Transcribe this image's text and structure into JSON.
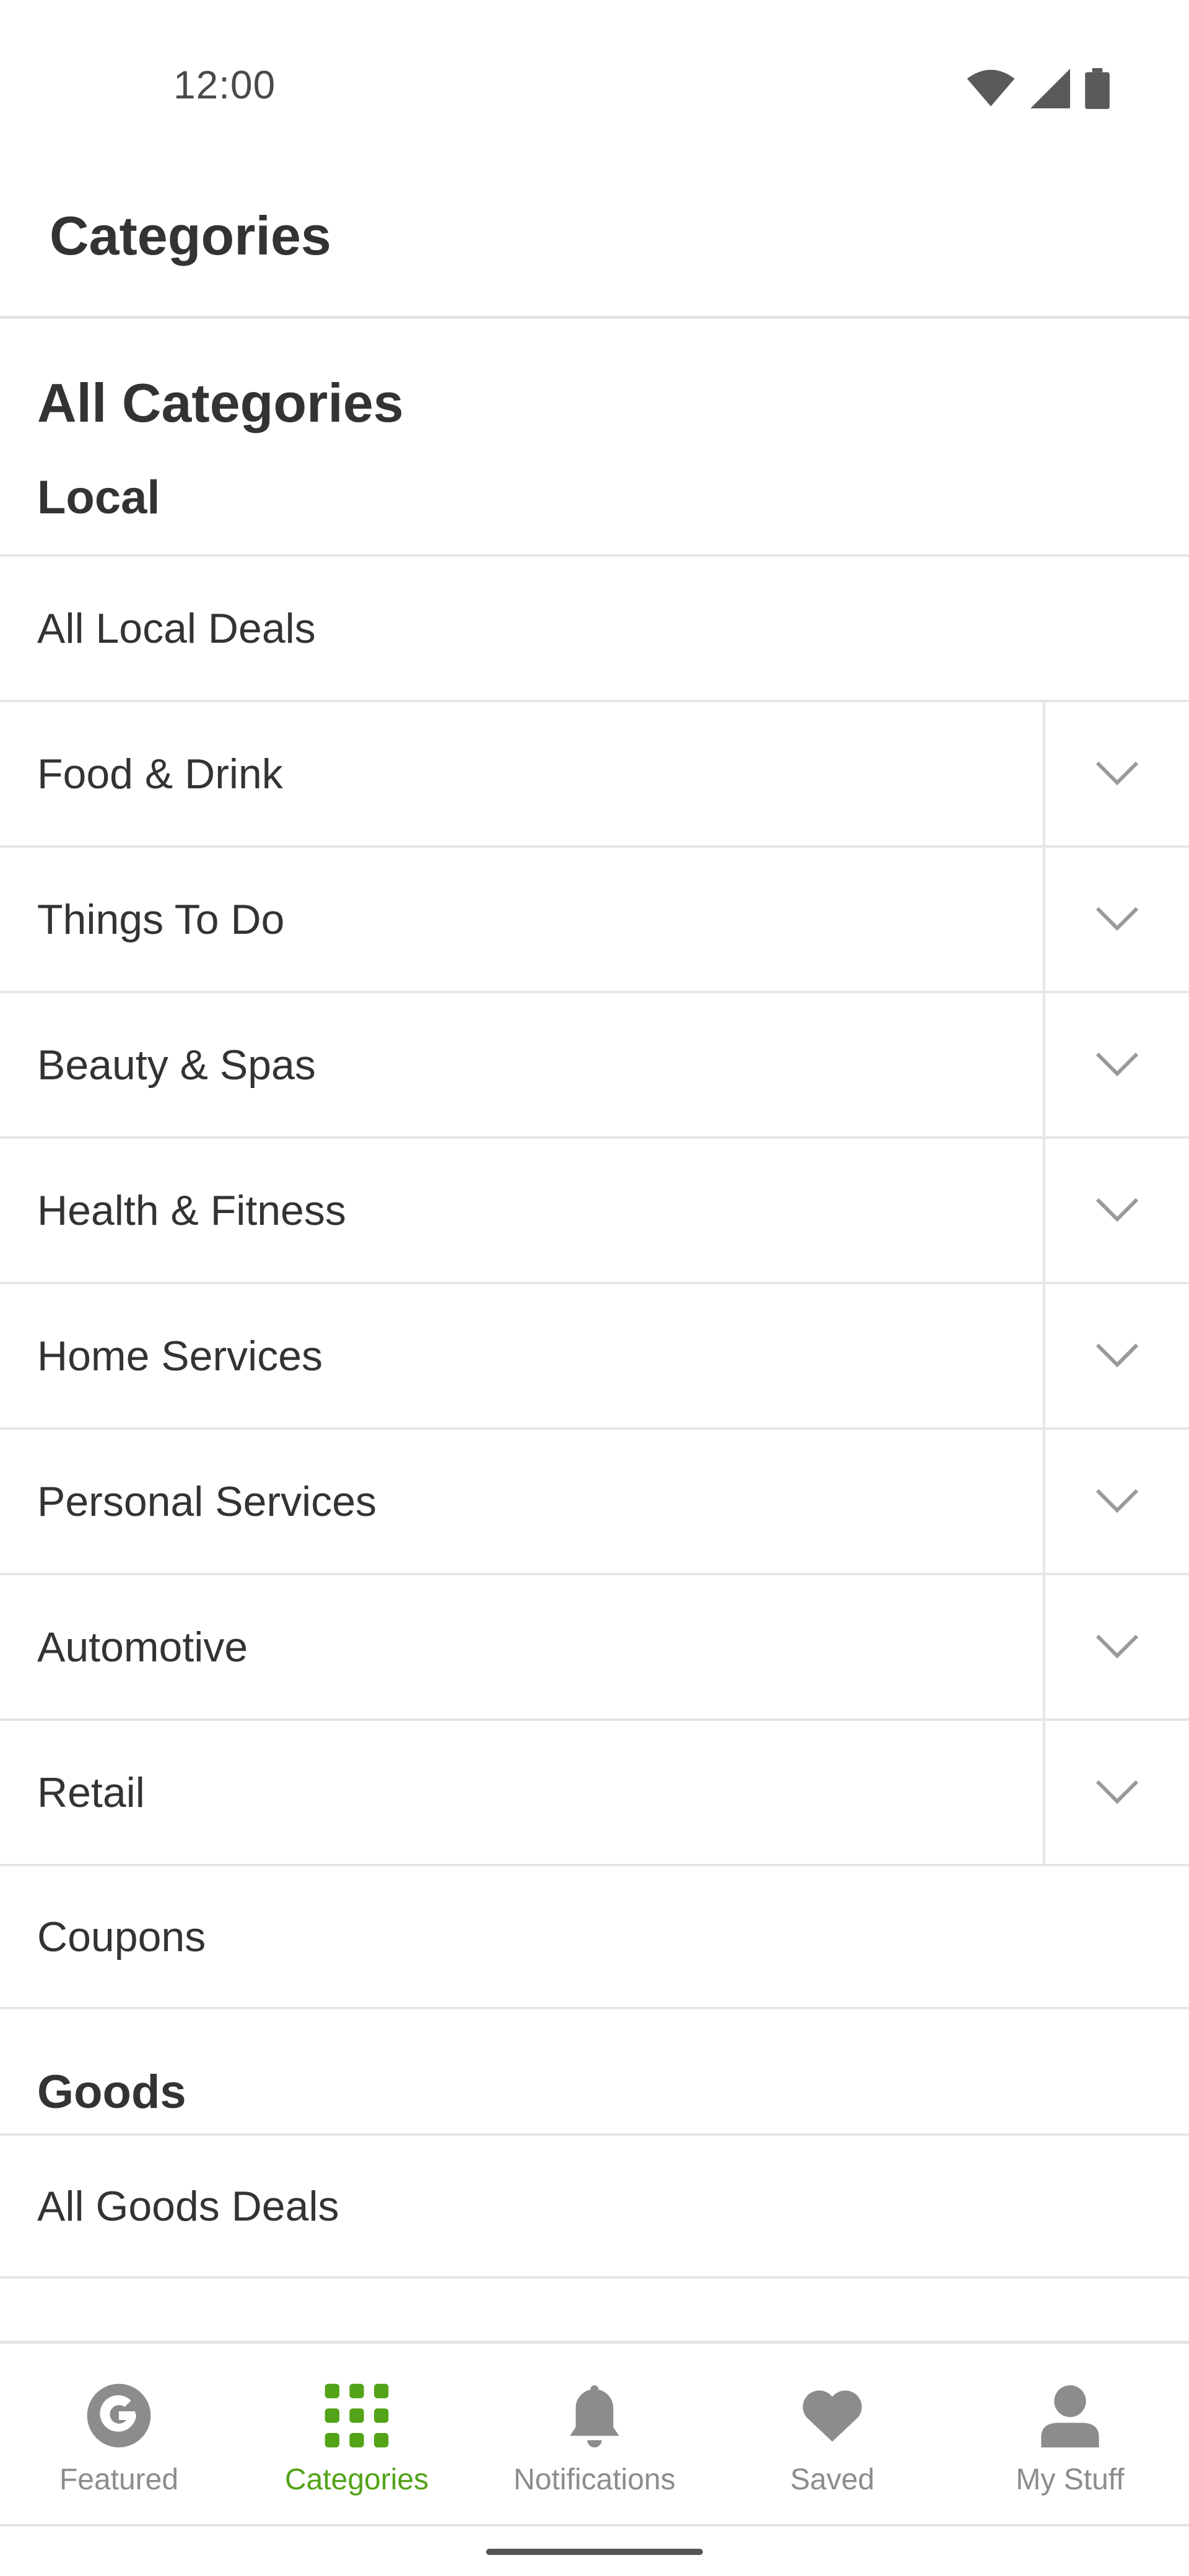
{
  "status_bar": {
    "time": "12:00"
  },
  "app_bar": {
    "title": "Categories"
  },
  "content": {
    "section_title": "All Categories",
    "groups": [
      {
        "heading": "Local",
        "items": [
          {
            "label": "All Local Deals",
            "expandable": false
          },
          {
            "label": "Food & Drink",
            "expandable": true
          },
          {
            "label": "Things To Do",
            "expandable": true
          },
          {
            "label": "Beauty & Spas",
            "expandable": true
          },
          {
            "label": "Health & Fitness",
            "expandable": true
          },
          {
            "label": "Home Services",
            "expandable": true
          },
          {
            "label": "Personal Services",
            "expandable": true
          },
          {
            "label": "Automotive",
            "expandable": true
          },
          {
            "label": "Retail",
            "expandable": true
          },
          {
            "label": "Coupons",
            "expandable": false
          }
        ]
      },
      {
        "heading": "Goods",
        "items": [
          {
            "label": "All Goods Deals",
            "expandable": false
          }
        ]
      }
    ]
  },
  "bottom_nav": {
    "items": [
      {
        "label": "Featured",
        "icon": "groupon-g-icon",
        "active": false
      },
      {
        "label": "Categories",
        "icon": "grid-icon",
        "active": true
      },
      {
        "label": "Notifications",
        "icon": "bell-icon",
        "active": false
      },
      {
        "label": "Saved",
        "icon": "heart-icon",
        "active": false
      },
      {
        "label": "My Stuff",
        "icon": "person-icon",
        "active": false
      }
    ]
  },
  "colors": {
    "accent": "#53a318",
    "inactive": "#8c8c8c",
    "text": "#333333",
    "divider": "#e6e6e6"
  }
}
